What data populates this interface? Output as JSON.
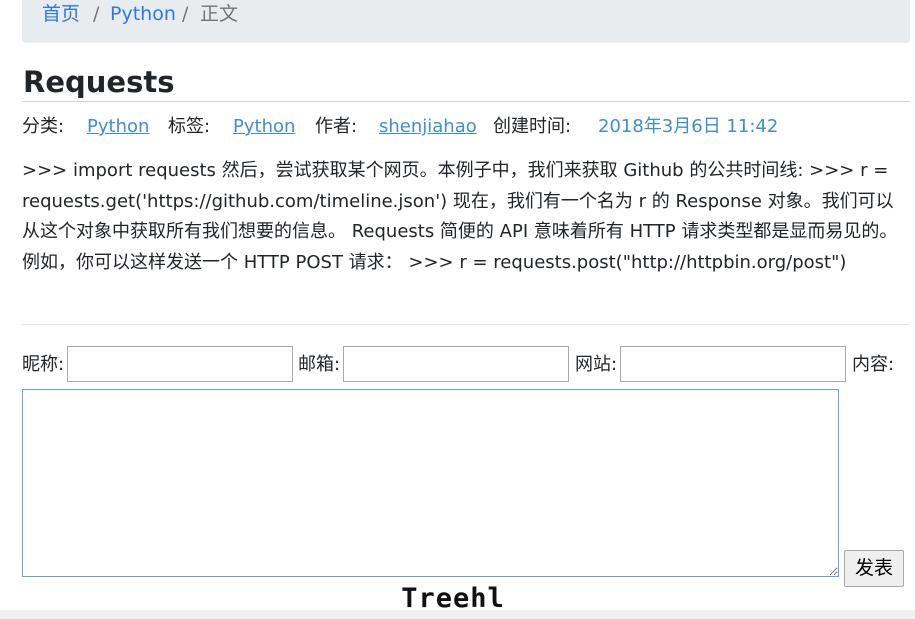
{
  "breadcrumb": {
    "home": "首页",
    "separator": "/",
    "category": "Python",
    "current": "正文"
  },
  "post": {
    "title": "Requests",
    "meta": {
      "category_label": "分类:",
      "category": "Python",
      "tags_label": "标签:",
      "tag": "Python",
      "author_label": "作者:",
      "author": "shenjiahao",
      "created_label": "创建时间:",
      "created": "2018年3月6日 11:42"
    },
    "body": ">>> import requests 然后，尝试获取某个网页。本例子中，我们来获取 Github 的公共时间线: >>> r = requests.get('https://github.com/timeline.json') 现在，我们有一个名为 r 的 Response 对象。我们可以从这个对象中获取所有我们想要的信息。 Requests 简便的 API 意味着所有 HTTP 请求类型都是显而易见的。例如，你可以这样发送一个 HTTP POST 请求： >>> r = requests.post(\"http://httpbin.org/post\")"
  },
  "comment_form": {
    "nickname_label": "昵称:",
    "nickname_value": "",
    "email_label": "邮箱:",
    "email_value": "",
    "website_label": "网站:",
    "website_value": "",
    "content_label": "内容:",
    "content_value": "",
    "submit_label": "发表"
  },
  "footer": {
    "logo_text": "Treehl"
  },
  "colors": {
    "link": "#2a7ae2",
    "meta_value": "#3e8ed0",
    "breadcrumb_bg": "#e9ecef",
    "textarea_border": "#6a9fd8"
  }
}
